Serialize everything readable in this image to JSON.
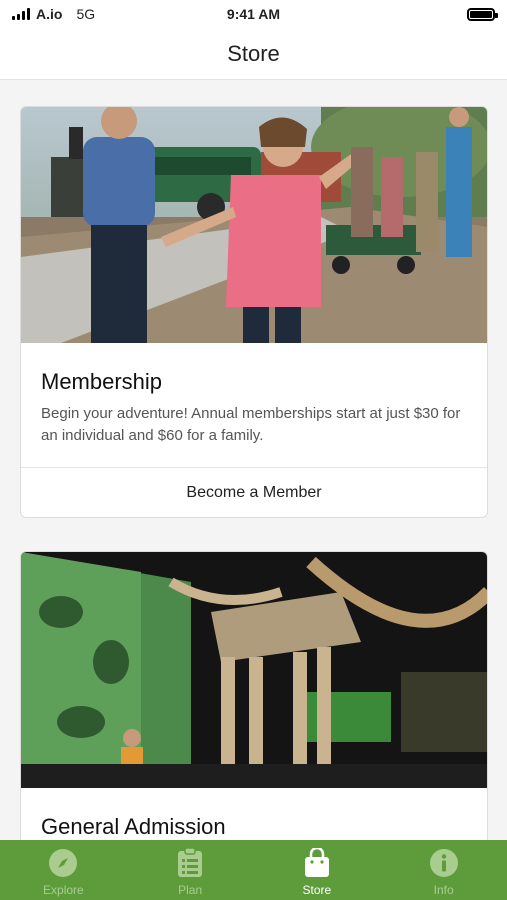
{
  "status_bar": {
    "carrier": "A.io",
    "network": "5G",
    "time": "9:41 AM"
  },
  "header": {
    "title": "Store"
  },
  "cards": [
    {
      "title": "Membership",
      "description": "Begin your adventure! Annual memberships start at just $30 for an individual and $60 for a family.",
      "action_label": "Become a Member",
      "image": "family-train-photo"
    },
    {
      "title": "General Admission",
      "image": "mammoth-skeleton-photo"
    }
  ],
  "tab_bar": {
    "items": [
      {
        "label": "Explore",
        "icon": "compass-icon",
        "active": false
      },
      {
        "label": "Plan",
        "icon": "clipboard-icon",
        "active": false
      },
      {
        "label": "Store",
        "icon": "shopping-bag-icon",
        "active": true
      },
      {
        "label": "Info",
        "icon": "info-icon",
        "active": false
      }
    ]
  },
  "colors": {
    "accent_green": "#5e9c3b",
    "inactive_tab": "#a9cd8f",
    "active_tab": "#ffffff"
  }
}
